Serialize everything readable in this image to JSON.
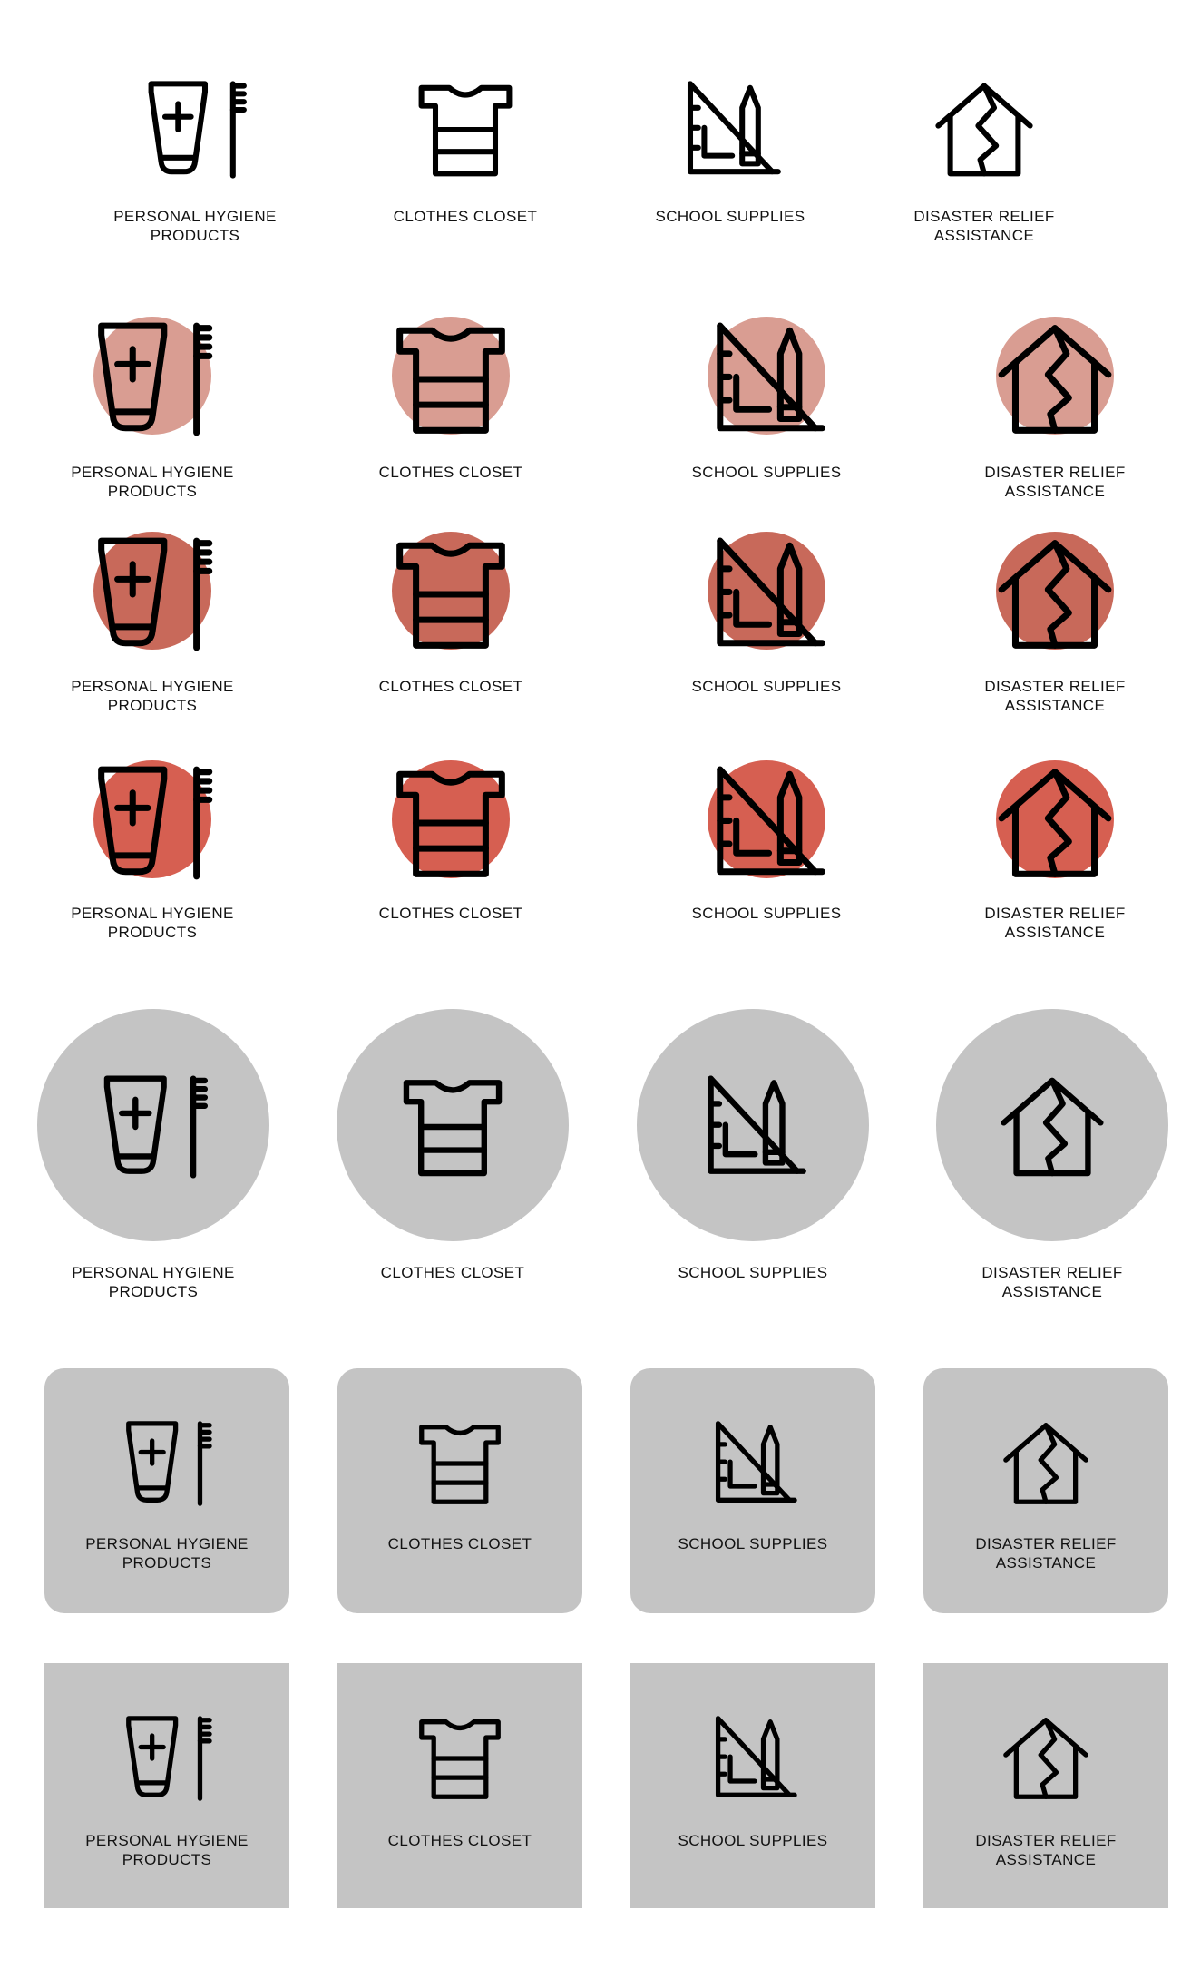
{
  "colors": {
    "light_red": "#d99d92",
    "mid_red": "#c8695a",
    "strong_red": "#d65f51",
    "grey": "#c4c4c4",
    "stroke": "#000000"
  },
  "icons": [
    "hygiene-icon",
    "shirt-icon",
    "school-supplies-icon",
    "house-crack-icon"
  ],
  "rows": [
    {
      "style": "plain",
      "items": [
        {
          "icon": "hygiene-icon",
          "label": "PERSONAL HYGIENE\nPRODUCTS"
        },
        {
          "icon": "shirt-icon",
          "label": "CLOTHES CLOSET"
        },
        {
          "icon": "school-supplies-icon",
          "label": "SCHOOL SUPPLIES"
        },
        {
          "icon": "house-crack-icon",
          "label": "DISASTER RELIEF\nASSISTANCE"
        }
      ]
    },
    {
      "style": "light-red-circle",
      "items": [
        {
          "icon": "hygiene-icon",
          "label": "PERSONAL HYGIENE\nPRODUCTS"
        },
        {
          "icon": "shirt-icon",
          "label": "CLOTHES CLOSET"
        },
        {
          "icon": "school-supplies-icon",
          "label": "SCHOOL SUPPLIES"
        },
        {
          "icon": "house-crack-icon",
          "label": "DISASTER RELIEF\nASSISTANCE"
        }
      ]
    },
    {
      "style": "mid-red-circle",
      "items": [
        {
          "icon": "hygiene-icon",
          "label": "PERSONAL HYGIENE\nPRODUCTS"
        },
        {
          "icon": "shirt-icon",
          "label": "CLOTHES CLOSET"
        },
        {
          "icon": "school-supplies-icon",
          "label": "SCHOOL SUPPLIES"
        },
        {
          "icon": "house-crack-icon",
          "label": "DISASTER RELIEF\nASSISTANCE"
        }
      ]
    },
    {
      "style": "strong-red-circle",
      "items": [
        {
          "icon": "hygiene-icon",
          "label": "PERSONAL HYGIENE\nPRODUCTS"
        },
        {
          "icon": "shirt-icon",
          "label": "CLOTHES CLOSET"
        },
        {
          "icon": "school-supplies-icon",
          "label": "SCHOOL SUPPLIES"
        },
        {
          "icon": "house-crack-icon",
          "label": "DISASTER RELIEF\nASSISTANCE"
        }
      ]
    },
    {
      "style": "grey-circle",
      "items": [
        {
          "icon": "hygiene-icon",
          "label": "PERSONAL HYGIENE\nPRODUCTS"
        },
        {
          "icon": "shirt-icon",
          "label": "CLOTHES CLOSET"
        },
        {
          "icon": "school-supplies-icon",
          "label": "SCHOOL SUPPLIES"
        },
        {
          "icon": "house-crack-icon",
          "label": "DISASTER RELIEF\nASSISTANCE"
        }
      ]
    },
    {
      "style": "grey-rounded-tile",
      "items": [
        {
          "icon": "hygiene-icon",
          "label": "PERSONAL HYGIENE\nPRODUCTS"
        },
        {
          "icon": "shirt-icon",
          "label": "CLOTHES CLOSET"
        },
        {
          "icon": "school-supplies-icon",
          "label": "SCHOOL SUPPLIES"
        },
        {
          "icon": "house-crack-icon",
          "label": "DISASTER RELIEF\nASSISTANCE"
        }
      ]
    },
    {
      "style": "grey-square-tile",
      "items": [
        {
          "icon": "hygiene-icon",
          "label": "PERSONAL HYGIENE\nPRODUCTS"
        },
        {
          "icon": "shirt-icon",
          "label": "CLOTHES CLOSET"
        },
        {
          "icon": "school-supplies-icon",
          "label": "SCHOOL SUPPLIES"
        },
        {
          "icon": "house-crack-icon",
          "label": "DISASTER RELIEF\nASSISTANCE"
        }
      ]
    }
  ]
}
